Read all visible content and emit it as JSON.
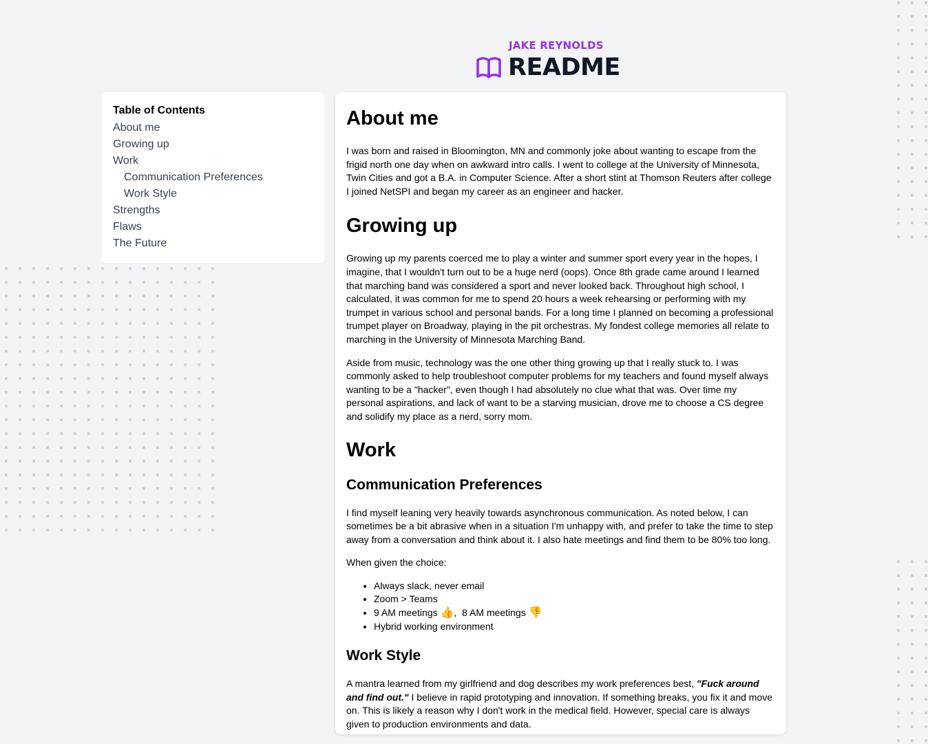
{
  "header": {
    "eyebrow": "JAKE REYNOLDS",
    "title": "README",
    "icon": "open-book-icon",
    "accent_color": "#9333ea",
    "title_color": "#111827"
  },
  "toc": {
    "heading": "Table of Contents",
    "items": [
      {
        "label": "About me",
        "level": 1
      },
      {
        "label": "Growing up",
        "level": 1
      },
      {
        "label": "Work",
        "level": 1
      },
      {
        "label": "Communication Preferences",
        "level": 2
      },
      {
        "label": "Work Style",
        "level": 2
      },
      {
        "label": "Strengths",
        "level": 1
      },
      {
        "label": "Flaws",
        "level": 1
      },
      {
        "label": "The Future",
        "level": 1
      }
    ]
  },
  "content": {
    "about": {
      "heading": "About me",
      "p1": "I was born and raised in Bloomington, MN and commonly joke about wanting to escape from the frigid north one day when on awkward intro calls. I went to college at the University of Minnesota, Twin Cities and got a B.A. in Computer Science. After a short stint at Thomson Reuters after college I joined NetSPI and began my career as an engineer and hacker."
    },
    "growing": {
      "heading": "Growing up",
      "p1": "Growing up my parents coerced me to play a winter and summer sport every year in the hopes, I imagine, that I wouldn't turn out to be a huge nerd (oops). Once 8th grade came around I learned that marching band was considered a sport and never looked back. Throughout high school, I calculated, it was common for me to spend 20 hours a week rehearsing or performing with my trumpet in various school and personal bands. For a long time I planned on becoming a professional trumpet player on Broadway, playing in the pit orchestras. My fondest college memories all relate to marching in the University of Minnesota Marching Band.",
      "p2": "Aside from music, technology was the one other thing growing up that I really stuck to. I was commonly asked to help troubleshoot computer problems for my teachers and found myself always wanting to be a \"hacker\", even though I had absolutely no clue what that was. Over time my personal aspirations, and lack of want to be a starving musician, drove me to choose a CS degree and solidify my place as a nerd, sorry mom."
    },
    "work": {
      "heading": "Work",
      "comm": {
        "heading": "Communication Preferences",
        "p1": "I find myself leaning very heavily towards asynchronous communication. As noted below, I can sometimes be a bit abrasive when in a situation I'm unhappy with, and prefer to take the time to step away from a conversation and think about it. I also hate meetings and find them to be 80% too long.",
        "p2": "When given the choice:",
        "list": {
          "item1": "Always slack, never email",
          "item2": "Zoom > Teams",
          "item3a": "9 AM meetings",
          "item3_emoji_a": "👍",
          "item3_sep": ",  8 AM meetings",
          "item3_emoji_b": "👎",
          "item4": "Hybrid working environment"
        }
      },
      "style": {
        "heading": "Work Style",
        "p1_a": "A mantra learned from my girlfriend and dog describes my work preferences best, ",
        "p1_quote": "\"Fuck around and find out.\"",
        "p1_b": " I believe in rapid prototyping and innovation. If something breaks, you fix it and move on. This is likely a reason why I don't work in the medical field. However, special care is always given to production environments and data."
      }
    }
  }
}
